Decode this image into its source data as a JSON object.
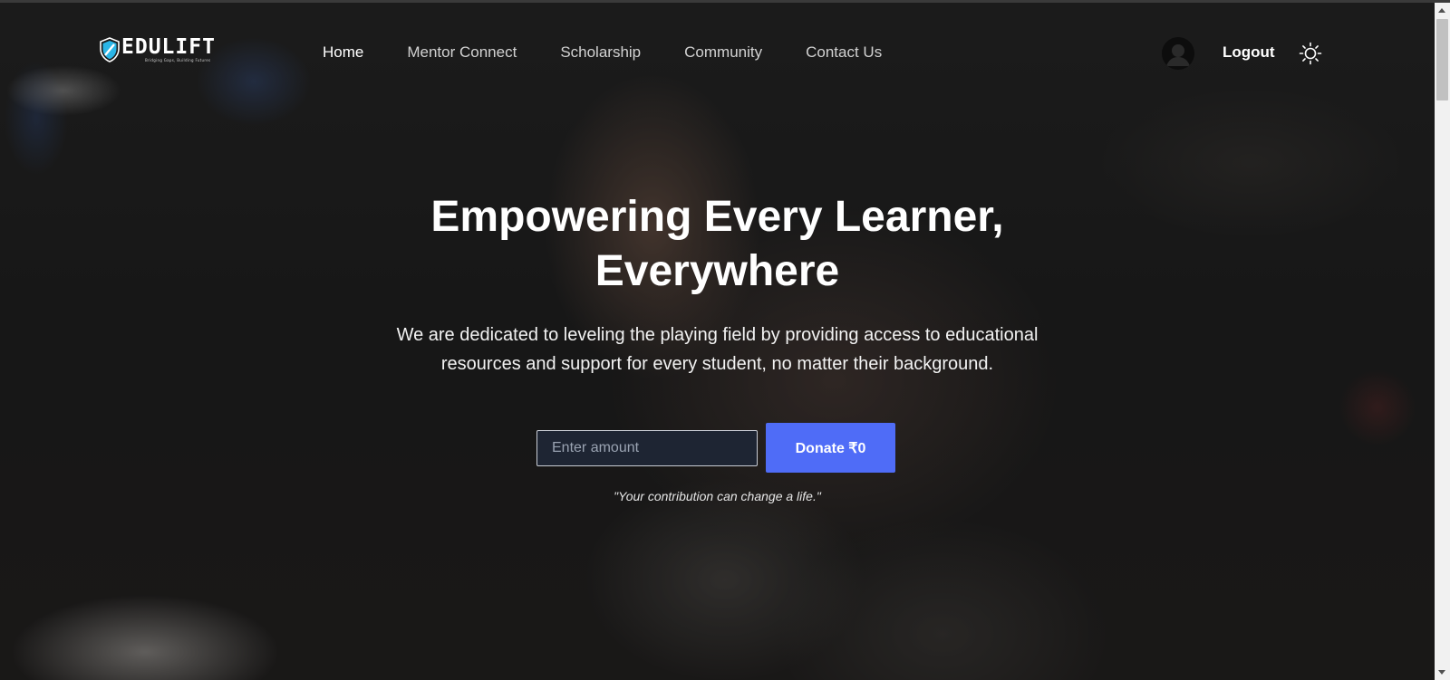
{
  "brand": {
    "name": "EDULIFT",
    "tagline": "Bridging Gaps, Building Futures",
    "logo_icon": "shield-icon",
    "accent_color": "#2bb5e6"
  },
  "nav": {
    "items": [
      {
        "label": "Home",
        "active": true
      },
      {
        "label": "Mentor Connect",
        "active": false
      },
      {
        "label": "Scholarship",
        "active": false
      },
      {
        "label": "Community",
        "active": false
      },
      {
        "label": "Contact Us",
        "active": false
      }
    ]
  },
  "header_actions": {
    "avatar_icon": "user-avatar-icon",
    "logout_label": "Logout",
    "theme_icon": "sun-icon"
  },
  "hero": {
    "title": "Empowering Every Learner, Everywhere",
    "subtitle": "We are dedicated to leveling the playing field by providing access to educational resources and support for every student, no matter their background."
  },
  "donation": {
    "amount_placeholder": "Enter amount",
    "amount_value": "",
    "button_label": "Donate ₹0",
    "button_color": "#4f6cf7",
    "quote": "\"Your contribution can change a life.\""
  }
}
